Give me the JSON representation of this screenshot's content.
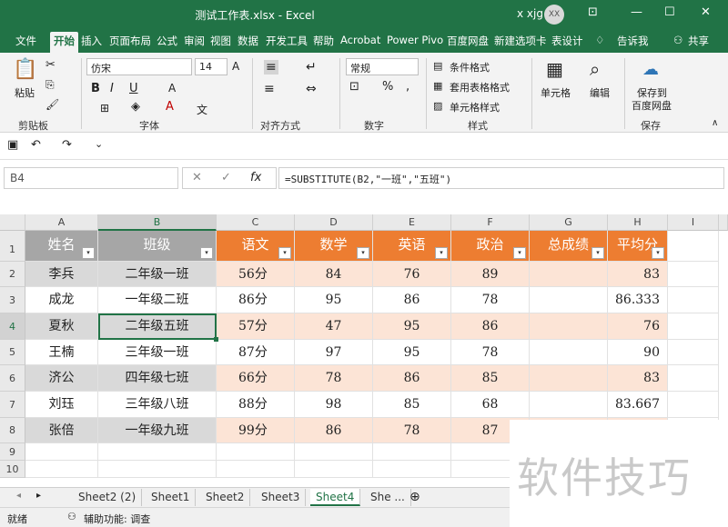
{
  "window": {
    "title": "测试工作表.xlsx  -  Excel",
    "user": "x xjg",
    "avatar": "XX"
  },
  "tabs": [
    "文件",
    "开始",
    "插入",
    "页面布局",
    "公式",
    "审阅",
    "视图",
    "数据",
    "开发工具",
    "帮助",
    "Acrobat",
    "Power Pivo",
    "百度网盘",
    "新建选项卡",
    "表设计",
    "告诉我",
    "共享"
  ],
  "ribbon": {
    "clipboard": {
      "paste": "粘贴",
      "label": "剪贴板"
    },
    "font": {
      "name": "仿宋",
      "size": "14",
      "label": "字体"
    },
    "align": {
      "label": "对齐方式"
    },
    "number": {
      "format": "常规",
      "label": "数字"
    },
    "styles": {
      "cond": "条件格式",
      "table": "套用表格格式",
      "cell": "单元格样式",
      "label": "样式"
    },
    "cells": {
      "btn": "单元格"
    },
    "edit": {
      "btn": "编辑"
    },
    "save": {
      "btn1": "保存到",
      "btn2": "百度网盘",
      "label": "保存"
    }
  },
  "formula_bar": {
    "name_box": "B4",
    "fx": "fx",
    "formula": "=SUBSTITUTE(B2,\"一班\",\"五班\")"
  },
  "columns": [
    "A",
    "B",
    "C",
    "D",
    "E",
    "F",
    "G",
    "H",
    "I"
  ],
  "rows": [
    "1",
    "2",
    "3",
    "4",
    "5",
    "6",
    "7",
    "8",
    "9",
    "10"
  ],
  "table": {
    "headers": [
      "姓名",
      "班级",
      "语文",
      "数学",
      "英语",
      "政治",
      "总成绩",
      "平均分"
    ],
    "data": [
      [
        "李兵",
        "二年级一班",
        "56分",
        "84",
        "76",
        "89",
        "",
        "83"
      ],
      [
        "成龙",
        "一年级二班",
        "86分",
        "95",
        "86",
        "78",
        "",
        "86.333"
      ],
      [
        "夏秋",
        "二年级五班",
        "57分",
        "47",
        "95",
        "86",
        "",
        "76"
      ],
      [
        "王楠",
        "三年级一班",
        "87分",
        "97",
        "95",
        "78",
        "",
        "90"
      ],
      [
        "济公",
        "四年级七班",
        "66分",
        "78",
        "86",
        "85",
        "",
        "83"
      ],
      [
        "刘珏",
        "三年级八班",
        "88分",
        "98",
        "85",
        "68",
        "",
        "83.667"
      ],
      [
        "张倍",
        "一年级九班",
        "99分",
        "86",
        "78",
        "87",
        "",
        ""
      ]
    ]
  },
  "sheets": [
    "Sheet2 (2)",
    "Sheet1",
    "Sheet2",
    "Sheet3",
    "Sheet4",
    "She ..."
  ],
  "status": {
    "ready": "就绪",
    "accessibility": "辅助功能: 调查"
  },
  "watermark": "软件技巧",
  "colors": {
    "brand": "#217346",
    "orange": "#ED7D31",
    "peach": "#FCE4D6",
    "gray_hdr": "#A6A6A6",
    "gray_band": "#D9D9D9"
  }
}
